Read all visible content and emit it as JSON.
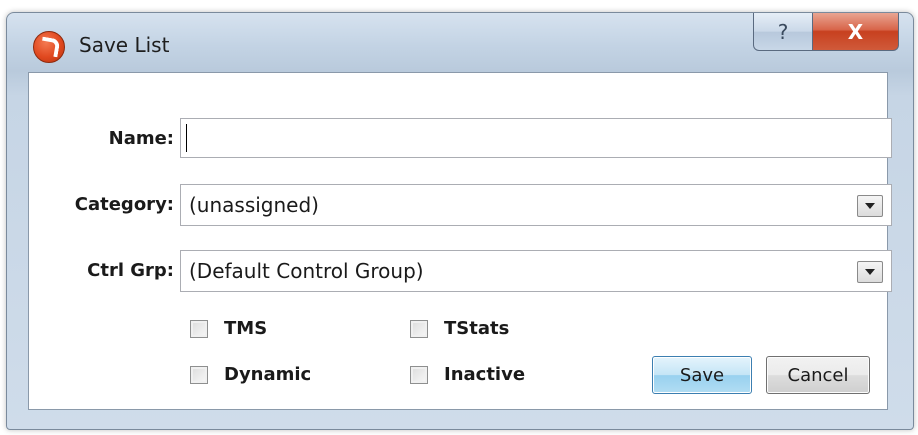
{
  "window": {
    "title": "Save List",
    "help_glyph": "?",
    "close_glyph": "X"
  },
  "form": {
    "name_label": "Name:",
    "name_value": "",
    "category_label": "Category:",
    "category_value": "(unassigned)",
    "ctrl_grp_label": "Ctrl Grp:",
    "ctrl_grp_value": "(Default Control Group)"
  },
  "options": {
    "tms": {
      "label": "TMS",
      "checked": false
    },
    "tstats": {
      "label": "TStats",
      "checked": false
    },
    "dynamic": {
      "label": "Dynamic",
      "checked": false
    },
    "inactive": {
      "label": "Inactive",
      "checked": false
    }
  },
  "buttons": {
    "save_label": "Save",
    "cancel_label": "Cancel"
  },
  "colors": {
    "titlebar": "#c6d5e5",
    "close_button": "#c7401f",
    "default_button_border": "#3c7fb1"
  },
  "icons": {
    "app_icon": "app-logo-icon",
    "dropdown_arrow": "chevron-down-icon"
  }
}
